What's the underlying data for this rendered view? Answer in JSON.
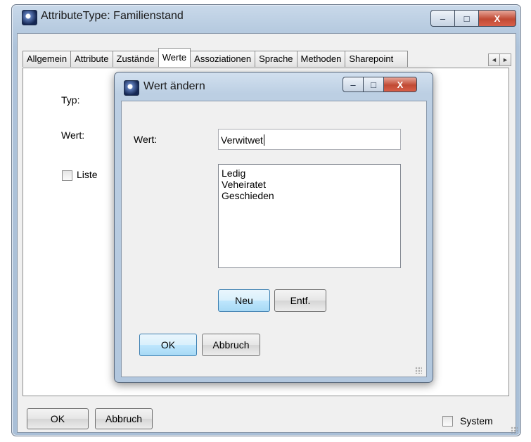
{
  "outer_window": {
    "title": "AttributeType: Familienstand",
    "controls": {
      "minimize": "–",
      "maximize": "□",
      "close": "X"
    }
  },
  "tabs": [
    {
      "label": "Allgemein"
    },
    {
      "label": "Attribute"
    },
    {
      "label": "Zustände"
    },
    {
      "label": "Werte",
      "active": true
    },
    {
      "label": "Assoziationen"
    },
    {
      "label": "Sprache"
    },
    {
      "label": "Methoden"
    },
    {
      "label": "Sharepoint"
    }
  ],
  "tab_scroll": {
    "left": "◄",
    "right": "►"
  },
  "form": {
    "typ_label": "Typ:",
    "wert_label": "Wert:",
    "liste_label": "Liste"
  },
  "footer": {
    "ok_label": "OK",
    "abbruch_label": "Abbruch",
    "system_label": "System"
  },
  "dialog": {
    "title": "Wert ändern",
    "controls": {
      "minimize": "–",
      "maximize": "□",
      "close": "X"
    },
    "wert_label": "Wert:",
    "wert_value": "Verwitwet",
    "list_items": [
      "Ledig",
      "Veheiratet",
      "Geschieden"
    ],
    "neu_label": "Neu",
    "entf_label": "Entf.",
    "ok_label": "OK",
    "abbruch_label": "Abbruch"
  },
  "colors": {
    "title_bar": "#b7cbe0",
    "close_button": "#c14a34",
    "default_button": "#a7d9f5"
  }
}
